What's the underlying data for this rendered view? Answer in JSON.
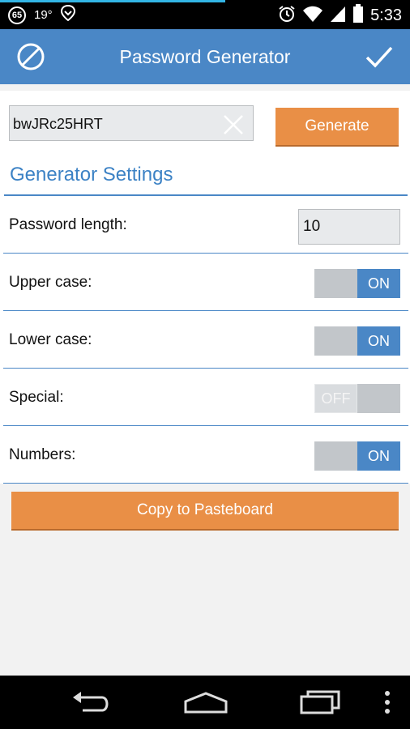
{
  "status_bar": {
    "notif_badge": "65",
    "temperature": "19°",
    "time": "5:33",
    "icons": [
      "notification-badge-icon",
      "location-icon",
      "alarm-icon",
      "wifi-icon",
      "signal-icon",
      "battery-icon"
    ],
    "progress_color": "#33b5e5"
  },
  "app_bar": {
    "title": "Password Generator",
    "left_icon": "cancel-icon",
    "right_icon": "checkmark-icon",
    "color": "#4a87c6"
  },
  "generator": {
    "password_value": "bwJRc25HRT",
    "clear_icon": "clear-icon",
    "generate_label": "Generate",
    "accent": "#e98f46"
  },
  "settings": {
    "header": "Generator Settings",
    "length_label": "Password length:",
    "length_value": "10",
    "toggles": [
      {
        "label": "Upper case:",
        "state": "ON"
      },
      {
        "label": "Lower case:",
        "state": "ON"
      },
      {
        "label": "Special:",
        "state": "OFF"
      },
      {
        "label": "Numbers:",
        "state": "ON"
      }
    ]
  },
  "actions": {
    "copy_label": "Copy to Pasteboard"
  },
  "nav_bar": {
    "icons": [
      "back-icon",
      "home-icon",
      "recents-icon",
      "overflow-menu-icon"
    ]
  }
}
